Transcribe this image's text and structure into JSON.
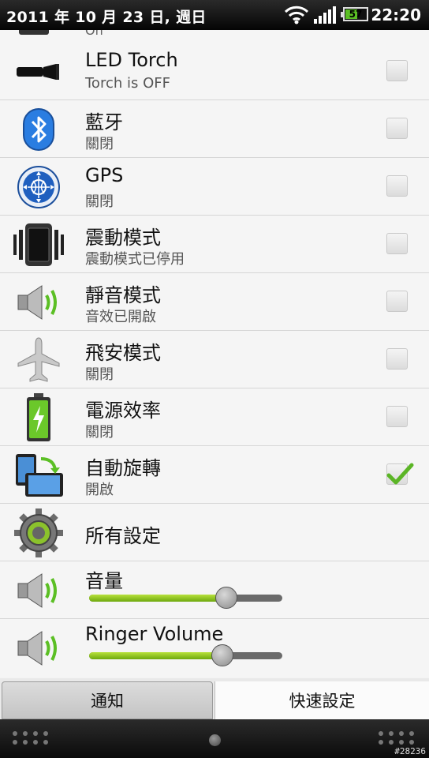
{
  "status_bar": {
    "date": "2011 年 10 月 23 日, 週日",
    "time": "22:20",
    "battery_level": "57"
  },
  "partial_row": {
    "subtitle": "On"
  },
  "settings": [
    {
      "id": "led-torch",
      "title": "LED Torch",
      "subtitle": "Torch is OFF",
      "checked": false,
      "icon": "torch-icon"
    },
    {
      "id": "bluetooth",
      "title": "藍牙",
      "subtitle": "關閉",
      "checked": false,
      "icon": "bluetooth-icon"
    },
    {
      "id": "gps",
      "title": "GPS",
      "subtitle": "關閉",
      "checked": false,
      "icon": "gps-icon"
    },
    {
      "id": "vibrate",
      "title": "震動模式",
      "subtitle": "震動模式已停用",
      "checked": false,
      "icon": "vibrate-icon"
    },
    {
      "id": "silent",
      "title": "靜音模式",
      "subtitle": "音效已開啟",
      "checked": false,
      "icon": "speaker-icon"
    },
    {
      "id": "airplane",
      "title": "飛安模式",
      "subtitle": "關閉",
      "checked": false,
      "icon": "airplane-icon"
    },
    {
      "id": "power-saver",
      "title": "電源效率",
      "subtitle": "關閉",
      "checked": false,
      "icon": "battery-icon"
    },
    {
      "id": "auto-rotate",
      "title": "自動旋轉",
      "subtitle": "開啟",
      "checked": true,
      "icon": "rotate-icon"
    },
    {
      "id": "all-settings",
      "title": "所有設定",
      "icon": "gear-icon"
    }
  ],
  "volume": {
    "label": "音量",
    "level": 0.71
  },
  "ringer_volume": {
    "label": "Ringer Volume",
    "level": 0.69
  },
  "tabs": [
    {
      "label": "通知",
      "active": true
    },
    {
      "label": "快速設定",
      "active": false
    }
  ],
  "watermark": "#28236",
  "colors": {
    "accent_green": "#6da80e",
    "statusbar": "#050505"
  }
}
